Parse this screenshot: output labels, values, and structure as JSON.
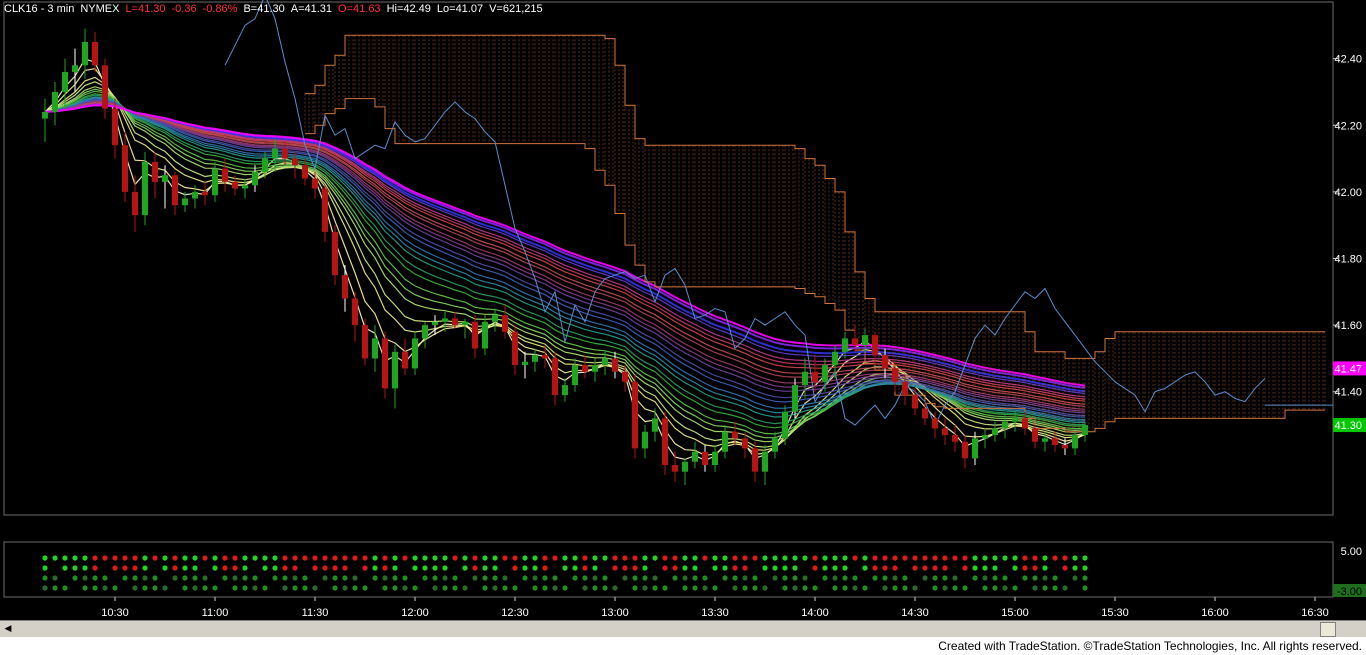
{
  "header": {
    "symbol": "CLK16 - 3 min",
    "exchange": "NYMEX",
    "last": "L=41.30",
    "change": "-0.36",
    "change_pct": "-0.86%",
    "bid": "B=41.30",
    "ask": "A=41.31",
    "open": "O=41.63",
    "high": "Hi=42.49",
    "low": "Lo=41.07",
    "volume": "V=621,215"
  },
  "colors": {
    "up": "#1fa51f",
    "down": "#b41414",
    "cloud": "#d2733c",
    "lagging": "#5a8ccc",
    "last_price_tag": "#00c800",
    "band_top_tag": "#ff00ff"
  },
  "chart_data": {
    "type": "candlestick",
    "symbol": "CLK16",
    "interval": "3 min",
    "x_ticks": [
      "10:30",
      "11:00",
      "11:30",
      "12:00",
      "12:30",
      "13:00",
      "13:30",
      "14:00",
      "14:30",
      "15:00",
      "15:30",
      "16:00",
      "16:30"
    ],
    "y_ticks": [
      "42.40",
      "42.20",
      "42.00",
      "41.80",
      "41.60",
      "41.40"
    ],
    "ylim": [
      41.03,
      42.57
    ],
    "price_tags": {
      "band_top": "41.47",
      "last": "41.30"
    },
    "lower_pane_ticks": [
      "5.00",
      "-3.00"
    ],
    "candle_interval_minutes": 3,
    "first_candle_time": "10:09",
    "candles": [
      {
        "o": 42.22,
        "h": 42.28,
        "l": 42.15,
        "c": 42.24
      },
      {
        "o": 42.24,
        "h": 42.33,
        "l": 42.2,
        "c": 42.3
      },
      {
        "o": 42.3,
        "h": 42.4,
        "l": 42.25,
        "c": 42.36
      },
      {
        "o": 42.36,
        "h": 42.43,
        "l": 42.3,
        "c": 42.38
      },
      {
        "o": 42.38,
        "h": 42.49,
        "l": 42.34,
        "c": 42.45
      },
      {
        "o": 42.45,
        "h": 42.48,
        "l": 42.36,
        "c": 42.38
      },
      {
        "o": 42.38,
        "h": 42.4,
        "l": 42.22,
        "c": 42.25
      },
      {
        "o": 42.25,
        "h": 42.28,
        "l": 42.1,
        "c": 42.14
      },
      {
        "o": 42.14,
        "h": 42.18,
        "l": 41.97,
        "c": 42.0
      },
      {
        "o": 42.0,
        "h": 42.05,
        "l": 41.88,
        "c": 41.93
      },
      {
        "o": 41.93,
        "h": 42.12,
        "l": 41.9,
        "c": 42.09
      },
      {
        "o": 42.09,
        "h": 42.12,
        "l": 41.98,
        "c": 42.03
      },
      {
        "o": 42.03,
        "h": 42.08,
        "l": 41.95,
        "c": 42.05
      },
      {
        "o": 42.05,
        "h": 42.06,
        "l": 41.93,
        "c": 41.96
      },
      {
        "o": 41.96,
        "h": 42.0,
        "l": 41.94,
        "c": 41.98
      },
      {
        "o": 41.98,
        "h": 42.02,
        "l": 41.95,
        "c": 42.0
      },
      {
        "o": 42.0,
        "h": 42.03,
        "l": 41.96,
        "c": 41.99
      },
      {
        "o": 41.99,
        "h": 42.09,
        "l": 41.97,
        "c": 42.07
      },
      {
        "o": 42.07,
        "h": 42.1,
        "l": 42.0,
        "c": 42.03
      },
      {
        "o": 42.03,
        "h": 42.05,
        "l": 41.99,
        "c": 42.01
      },
      {
        "o": 42.01,
        "h": 42.04,
        "l": 41.98,
        "c": 42.02
      },
      {
        "o": 42.02,
        "h": 42.08,
        "l": 42.0,
        "c": 42.06
      },
      {
        "o": 42.06,
        "h": 42.12,
        "l": 42.04,
        "c": 42.1
      },
      {
        "o": 42.1,
        "h": 42.16,
        "l": 42.06,
        "c": 42.13
      },
      {
        "o": 42.13,
        "h": 42.15,
        "l": 42.08,
        "c": 42.1
      },
      {
        "o": 42.1,
        "h": 42.12,
        "l": 42.04,
        "c": 42.08
      },
      {
        "o": 42.08,
        "h": 42.1,
        "l": 42.02,
        "c": 42.04
      },
      {
        "o": 42.04,
        "h": 42.06,
        "l": 41.98,
        "c": 42.01
      },
      {
        "o": 42.01,
        "h": 42.02,
        "l": 41.85,
        "c": 41.88
      },
      {
        "o": 41.88,
        "h": 41.9,
        "l": 41.72,
        "c": 41.75
      },
      {
        "o": 41.75,
        "h": 41.78,
        "l": 41.64,
        "c": 41.68
      },
      {
        "o": 41.68,
        "h": 41.7,
        "l": 41.55,
        "c": 41.6
      },
      {
        "o": 41.6,
        "h": 41.62,
        "l": 41.48,
        "c": 41.5
      },
      {
        "o": 41.5,
        "h": 41.6,
        "l": 41.46,
        "c": 41.56
      },
      {
        "o": 41.56,
        "h": 41.58,
        "l": 41.38,
        "c": 41.41
      },
      {
        "o": 41.41,
        "h": 41.54,
        "l": 41.35,
        "c": 41.52
      },
      {
        "o": 41.52,
        "h": 41.56,
        "l": 41.45,
        "c": 41.47
      },
      {
        "o": 41.47,
        "h": 41.58,
        "l": 41.45,
        "c": 41.56
      },
      {
        "o": 41.56,
        "h": 41.61,
        "l": 41.53,
        "c": 41.6
      },
      {
        "o": 41.6,
        "h": 41.63,
        "l": 41.57,
        "c": 41.61
      },
      {
        "o": 41.61,
        "h": 41.64,
        "l": 41.58,
        "c": 41.62
      },
      {
        "o": 41.62,
        "h": 41.64,
        "l": 41.59,
        "c": 41.6
      },
      {
        "o": 41.6,
        "h": 41.62,
        "l": 41.56,
        "c": 41.61
      },
      {
        "o": 41.61,
        "h": 41.63,
        "l": 41.5,
        "c": 41.53
      },
      {
        "o": 41.53,
        "h": 41.63,
        "l": 41.51,
        "c": 41.61
      },
      {
        "o": 41.61,
        "h": 41.65,
        "l": 41.58,
        "c": 41.63
      },
      {
        "o": 41.63,
        "h": 41.66,
        "l": 41.56,
        "c": 41.58
      },
      {
        "o": 41.58,
        "h": 41.6,
        "l": 41.45,
        "c": 41.48
      },
      {
        "o": 41.48,
        "h": 41.52,
        "l": 41.44,
        "c": 41.49
      },
      {
        "o": 41.49,
        "h": 41.53,
        "l": 41.46,
        "c": 41.51
      },
      {
        "o": 41.51,
        "h": 41.54,
        "l": 41.47,
        "c": 41.5
      },
      {
        "o": 41.5,
        "h": 41.52,
        "l": 41.36,
        "c": 41.39
      },
      {
        "o": 41.39,
        "h": 41.44,
        "l": 41.37,
        "c": 41.42
      },
      {
        "o": 41.42,
        "h": 41.5,
        "l": 41.4,
        "c": 41.48
      },
      {
        "o": 41.48,
        "h": 41.51,
        "l": 41.44,
        "c": 41.46
      },
      {
        "o": 41.46,
        "h": 41.5,
        "l": 41.43,
        "c": 41.48
      },
      {
        "o": 41.48,
        "h": 41.52,
        "l": 41.45,
        "c": 41.5
      },
      {
        "o": 41.5,
        "h": 41.52,
        "l": 41.44,
        "c": 41.46
      },
      {
        "o": 41.46,
        "h": 41.48,
        "l": 41.4,
        "c": 41.43
      },
      {
        "o": 41.43,
        "h": 41.45,
        "l": 41.2,
        "c": 41.23
      },
      {
        "o": 41.23,
        "h": 41.3,
        "l": 41.2,
        "c": 41.28
      },
      {
        "o": 41.28,
        "h": 41.35,
        "l": 41.25,
        "c": 41.32
      },
      {
        "o": 41.32,
        "h": 41.34,
        "l": 41.15,
        "c": 41.18
      },
      {
        "o": 41.18,
        "h": 41.22,
        "l": 41.13,
        "c": 41.16
      },
      {
        "o": 41.16,
        "h": 41.2,
        "l": 41.12,
        "c": 41.19
      },
      {
        "o": 41.19,
        "h": 41.25,
        "l": 41.17,
        "c": 41.22
      },
      {
        "o": 41.22,
        "h": 41.24,
        "l": 41.16,
        "c": 41.18
      },
      {
        "o": 41.18,
        "h": 41.24,
        "l": 41.16,
        "c": 41.22
      },
      {
        "o": 41.22,
        "h": 41.3,
        "l": 41.2,
        "c": 41.28
      },
      {
        "o": 41.28,
        "h": 41.31,
        "l": 41.24,
        "c": 41.26
      },
      {
        "o": 41.26,
        "h": 41.28,
        "l": 41.2,
        "c": 41.23
      },
      {
        "o": 41.23,
        "h": 41.25,
        "l": 41.13,
        "c": 41.16
      },
      {
        "o": 41.16,
        "h": 41.24,
        "l": 41.12,
        "c": 41.22
      },
      {
        "o": 41.22,
        "h": 41.28,
        "l": 41.2,
        "c": 41.26
      },
      {
        "o": 41.26,
        "h": 41.36,
        "l": 41.24,
        "c": 41.34
      },
      {
        "o": 41.34,
        "h": 41.44,
        "l": 41.32,
        "c": 41.42
      },
      {
        "o": 41.42,
        "h": 41.5,
        "l": 41.38,
        "c": 41.46
      },
      {
        "o": 41.46,
        "h": 41.51,
        "l": 41.4,
        "c": 41.43
      },
      {
        "o": 41.43,
        "h": 41.5,
        "l": 41.4,
        "c": 41.48
      },
      {
        "o": 41.48,
        "h": 41.54,
        "l": 41.44,
        "c": 41.52
      },
      {
        "o": 41.52,
        "h": 41.58,
        "l": 41.5,
        "c": 41.56
      },
      {
        "o": 41.56,
        "h": 41.6,
        "l": 41.52,
        "c": 41.54
      },
      {
        "o": 41.54,
        "h": 41.59,
        "l": 41.52,
        "c": 41.57
      },
      {
        "o": 41.57,
        "h": 41.58,
        "l": 41.48,
        "c": 41.51
      },
      {
        "o": 41.51,
        "h": 41.53,
        "l": 41.44,
        "c": 41.47
      },
      {
        "o": 41.47,
        "h": 41.49,
        "l": 41.4,
        "c": 41.43
      },
      {
        "o": 41.43,
        "h": 41.45,
        "l": 41.36,
        "c": 41.39
      },
      {
        "o": 41.39,
        "h": 41.41,
        "l": 41.33,
        "c": 41.35
      },
      {
        "o": 41.35,
        "h": 41.37,
        "l": 41.3,
        "c": 41.32
      },
      {
        "o": 41.32,
        "h": 41.34,
        "l": 41.26,
        "c": 41.29
      },
      {
        "o": 41.29,
        "h": 41.32,
        "l": 41.24,
        "c": 41.27
      },
      {
        "o": 41.27,
        "h": 41.3,
        "l": 41.22,
        "c": 41.25
      },
      {
        "o": 41.25,
        "h": 41.27,
        "l": 41.17,
        "c": 41.2
      },
      {
        "o": 41.2,
        "h": 41.28,
        "l": 41.18,
        "c": 41.26
      },
      {
        "o": 41.26,
        "h": 41.29,
        "l": 41.23,
        "c": 41.27
      },
      {
        "o": 41.27,
        "h": 41.31,
        "l": 41.25,
        "c": 41.29
      },
      {
        "o": 41.29,
        "h": 41.33,
        "l": 41.26,
        "c": 41.31
      },
      {
        "o": 41.31,
        "h": 41.34,
        "l": 41.28,
        "c": 41.32
      },
      {
        "o": 41.32,
        "h": 41.34,
        "l": 41.27,
        "c": 41.29
      },
      {
        "o": 41.29,
        "h": 41.3,
        "l": 41.23,
        "c": 41.25
      },
      {
        "o": 41.25,
        "h": 41.28,
        "l": 41.22,
        "c": 41.26
      },
      {
        "o": 41.26,
        "h": 41.28,
        "l": 41.22,
        "c": 41.24
      },
      {
        "o": 41.24,
        "h": 41.26,
        "l": 41.21,
        "c": 41.23
      },
      {
        "o": 41.23,
        "h": 41.28,
        "l": 41.21,
        "c": 41.27
      },
      {
        "o": 41.27,
        "h": 41.31,
        "l": 41.25,
        "c": 41.3
      }
    ]
  },
  "footer": {
    "copyright": "Created with TradeStation. ©TradeStation Technologies, Inc. All rights reserved."
  }
}
